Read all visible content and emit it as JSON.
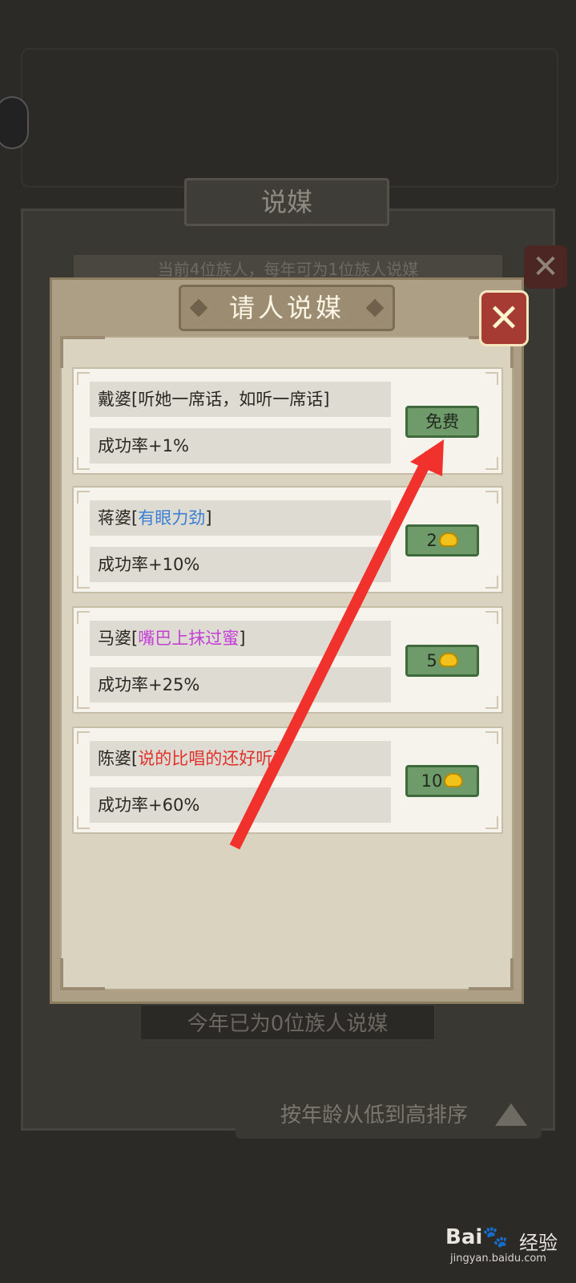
{
  "background": {
    "title": "说媒",
    "info_text": "当前4位族人，每年可为1位族人说媒",
    "count_text": "今年已为0位族人说媒",
    "sort_label": "按年龄从低到高排序"
  },
  "modal": {
    "title": "请人说媒",
    "close_icon": "✕",
    "matchmakers": [
      {
        "name": "戴婆[听她一席话，如听一席话]",
        "prefix": "戴婆[",
        "trait": "听她一席话，如听一席话",
        "suffix": "]",
        "trait_color": "#2b2824",
        "rate": "成功率+1%",
        "cost": "免费",
        "cost_type": "free"
      },
      {
        "name": "蒋婆[有眼力劲]",
        "prefix": "蒋婆[",
        "trait": "有眼力劲",
        "suffix": "]",
        "trait_color": "#3a7fd4",
        "rate": "成功率+10%",
        "cost": "2",
        "cost_type": "ingot"
      },
      {
        "name": "马婆[嘴巴上抹过蜜]",
        "prefix": "马婆[",
        "trait": "嘴巴上抹过蜜",
        "suffix": "]",
        "trait_color": "#c43fd6",
        "rate": "成功率+25%",
        "cost": "5",
        "cost_type": "ingot"
      },
      {
        "name": "陈婆[说的比唱的还好听]",
        "prefix": "陈婆[",
        "trait": "说的比唱的还好听",
        "suffix": "]",
        "trait_color": "#e0322c",
        "rate": "成功率+60%",
        "cost": "10",
        "cost_type": "ingot"
      }
    ]
  },
  "annotation": {
    "color": "#f0312c"
  },
  "watermark": {
    "brand": "Bai",
    "paw": "🐾",
    "cn": "经验",
    "url": "jingyan.baidu.com"
  },
  "colors": {
    "accent_green": "#6f9a6a",
    "close_red": "#a63b34",
    "ingot_gold": "#f2c21a"
  }
}
